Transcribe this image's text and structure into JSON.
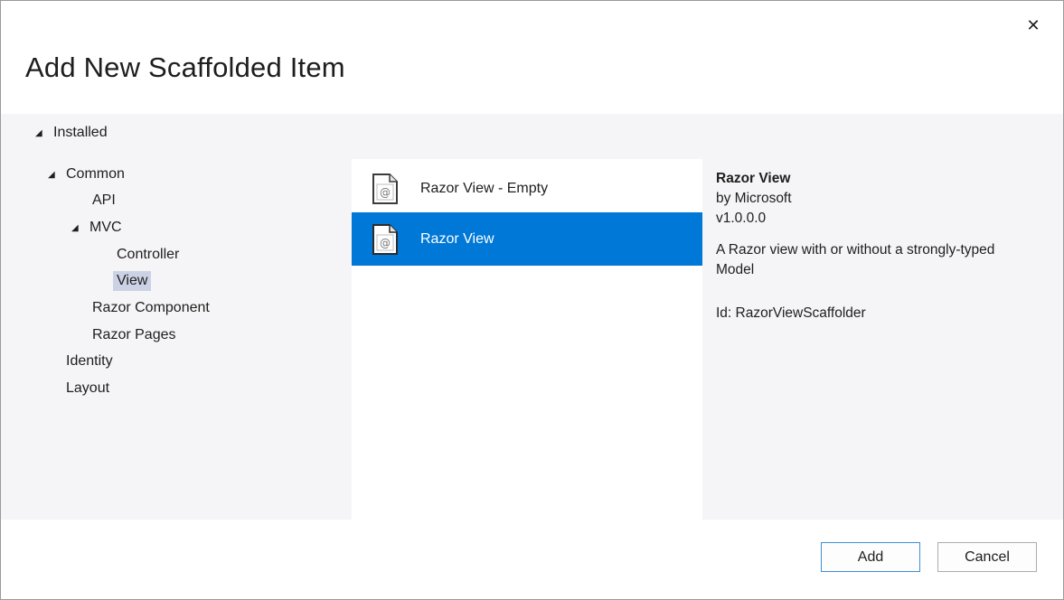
{
  "dialog": {
    "title": "Add New Scaffolded Item",
    "close_glyph": "✕"
  },
  "tree": {
    "expand_glyph": "◢",
    "installed": "Installed",
    "common": "Common",
    "api": "API",
    "mvc": "MVC",
    "controller": "Controller",
    "view": "View",
    "razor_component": "Razor Component",
    "razor_pages": "Razor Pages",
    "identity": "Identity",
    "layout": "Layout"
  },
  "templates": [
    {
      "label": "Razor View - Empty",
      "icon": "razor-file-icon",
      "selected": false
    },
    {
      "label": "Razor View",
      "icon": "razor-file-icon",
      "selected": true
    }
  ],
  "details": {
    "title": "Razor View",
    "author": "by Microsoft",
    "version": "v1.0.0.0",
    "description": "A Razor view with or without a strongly-typed Model",
    "id": "Id: RazorViewScaffolder"
  },
  "footer": {
    "add_label": "Add",
    "cancel_label": "Cancel"
  },
  "colors": {
    "accent": "#0078d7",
    "tree_selection": "#ccd2e5",
    "panel_background": "#f5f5f7"
  }
}
